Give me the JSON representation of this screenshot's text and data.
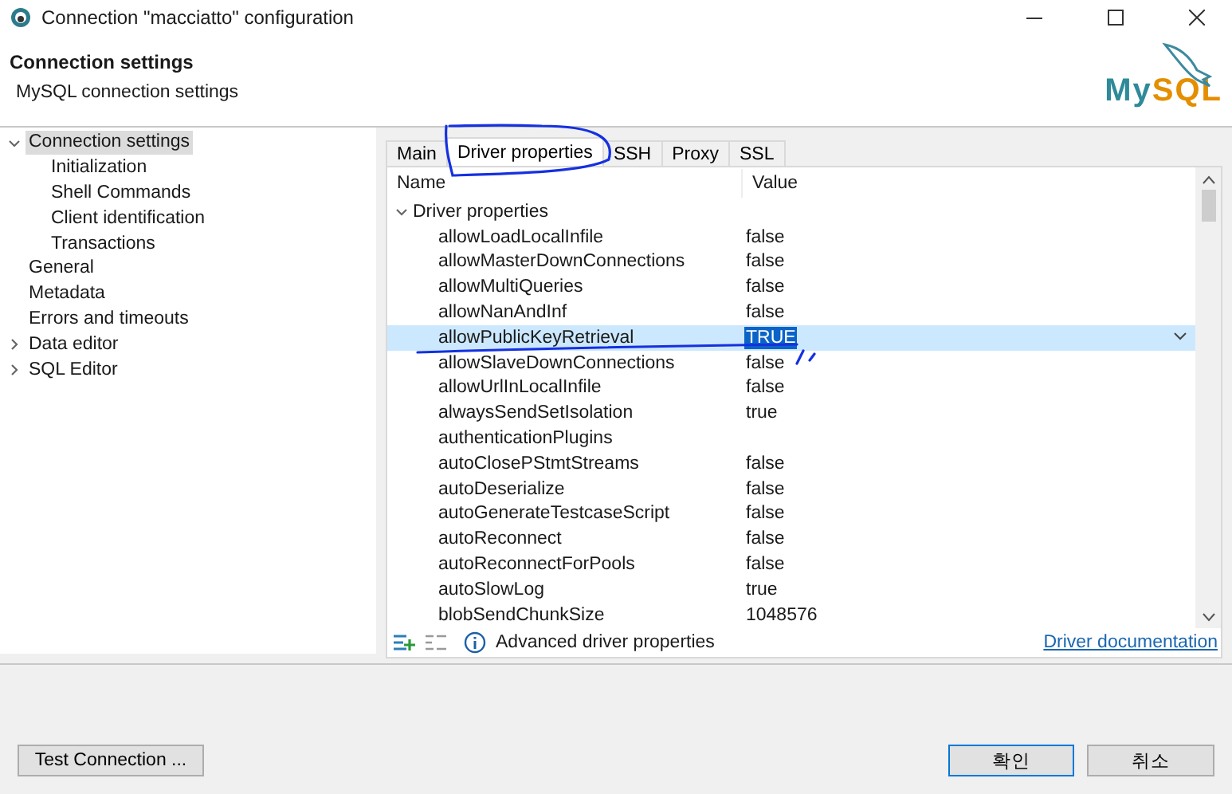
{
  "window": {
    "title": "Connection \"macciatto\" configuration"
  },
  "header": {
    "title": "Connection settings",
    "subtitle": "MySQL connection settings",
    "logo_part_1": "My",
    "logo_part_2": "SQL"
  },
  "sidebar": {
    "items": [
      {
        "label": "Connection settings",
        "selected": true,
        "expanded": true,
        "children": [
          {
            "label": "Initialization",
            "selected": false
          },
          {
            "label": "Shell Commands",
            "selected": false
          },
          {
            "label": "Client identification",
            "selected": false
          },
          {
            "label": "Transactions",
            "selected": false
          }
        ]
      },
      {
        "label": "General",
        "selected": false
      },
      {
        "label": "Metadata",
        "selected": false
      },
      {
        "label": "Errors and timeouts",
        "selected": false
      },
      {
        "label": "Data editor",
        "selected": false,
        "expanded": false
      },
      {
        "label": "SQL Editor",
        "selected": false,
        "expanded": false
      }
    ]
  },
  "tabs": [
    {
      "label": "Main",
      "selected": false
    },
    {
      "label": "Driver properties",
      "selected": true
    },
    {
      "label": "SSH",
      "selected": false
    },
    {
      "label": "Proxy",
      "selected": false
    },
    {
      "label": "SSL",
      "selected": false
    }
  ],
  "table": {
    "columns": [
      "Name",
      "Value"
    ],
    "group": {
      "label": "Driver properties",
      "expanded": true
    },
    "rows": [
      {
        "name": "allowLoadLocalInfile",
        "value": "false",
        "selected": false
      },
      {
        "name": "allowMasterDownConnections",
        "value": "false",
        "selected": false
      },
      {
        "name": "allowMultiQueries",
        "value": "false",
        "selected": false
      },
      {
        "name": "allowNanAndInf",
        "value": "false",
        "selected": false
      },
      {
        "name": "allowPublicKeyRetrieval",
        "value": "TRUE",
        "selected": true
      },
      {
        "name": "allowSlaveDownConnections",
        "value": "false",
        "selected": false
      },
      {
        "name": "allowUrlInLocalInfile",
        "value": "false",
        "selected": false
      },
      {
        "name": "alwaysSendSetIsolation",
        "value": "true",
        "selected": false
      },
      {
        "name": "authenticationPlugins",
        "value": "",
        "selected": false
      },
      {
        "name": "autoClosePStmtStreams",
        "value": "false",
        "selected": false
      },
      {
        "name": "autoDeserialize",
        "value": "false",
        "selected": false
      },
      {
        "name": "autoGenerateTestcaseScript",
        "value": "false",
        "selected": false
      },
      {
        "name": "autoReconnect",
        "value": "false",
        "selected": false
      },
      {
        "name": "autoReconnectForPools",
        "value": "false",
        "selected": false
      },
      {
        "name": "autoSlowLog",
        "value": "true",
        "selected": false
      },
      {
        "name": "blobSendChunkSize",
        "value": "1048576",
        "selected": false
      }
    ]
  },
  "table_footer": {
    "info": "Advanced driver properties",
    "link": "Driver documentation"
  },
  "buttons": {
    "test": "Test Connection ...",
    "ok": "확인",
    "cancel": "취소"
  }
}
